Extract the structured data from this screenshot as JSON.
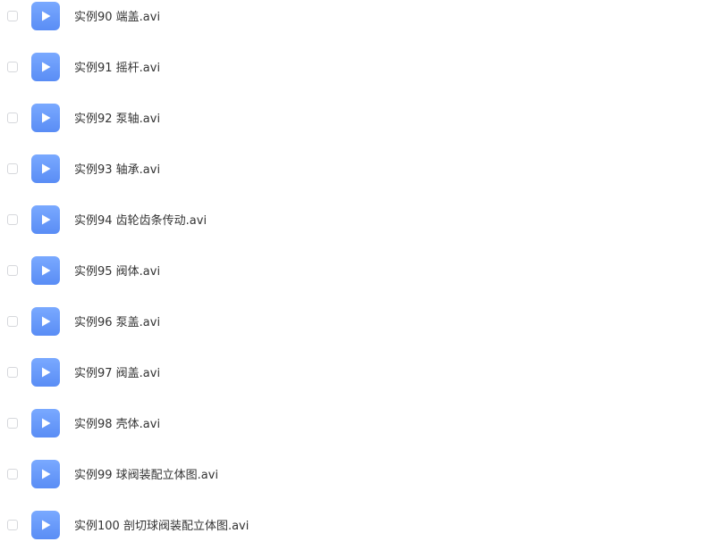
{
  "files": [
    {
      "name": "实例90 端盖.avi",
      "icon": "video-play-icon"
    },
    {
      "name": "实例91 摇杆.avi",
      "icon": "video-play-icon"
    },
    {
      "name": "实例92 泵轴.avi",
      "icon": "video-play-icon"
    },
    {
      "name": "实例93 轴承.avi",
      "icon": "video-play-icon"
    },
    {
      "name": "实例94 齿轮齿条传动.avi",
      "icon": "video-play-icon"
    },
    {
      "name": "实例95 阀体.avi",
      "icon": "video-play-icon"
    },
    {
      "name": "实例96 泵盖.avi",
      "icon": "video-play-icon"
    },
    {
      "name": "实例97 阀盖.avi",
      "icon": "video-play-icon"
    },
    {
      "name": "实例98 壳体.avi",
      "icon": "video-play-icon"
    },
    {
      "name": "实例99 球阀装配立体图.avi",
      "icon": "video-play-icon"
    },
    {
      "name": "实例100 剖切球阀装配立体图.avi",
      "icon": "video-play-icon"
    }
  ],
  "colors": {
    "icon_gradient_top": "#7aa9ff",
    "icon_gradient_bottom": "#5a8df5",
    "text": "#333333",
    "checkbox_border": "#d6d8dc"
  }
}
